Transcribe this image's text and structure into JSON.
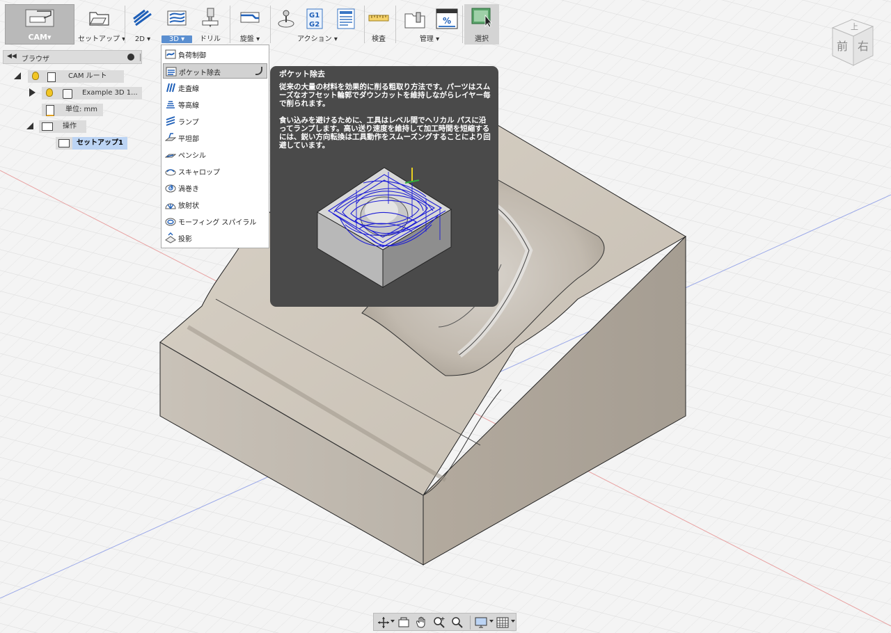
{
  "toolbar": {
    "workspace": {
      "label": "CAM▾"
    },
    "groups": [
      {
        "label": "セットアップ ▾"
      },
      {
        "label": "2D ▾"
      },
      {
        "label": "3D ▾"
      },
      {
        "label": "ドリル"
      },
      {
        "label": "旋盤 ▾"
      },
      {
        "label": "アクション ▾"
      },
      {
        "label": "検査"
      },
      {
        "label": "管理 ▾"
      },
      {
        "label": "選択"
      }
    ],
    "gcode_icon_text": [
      "G1",
      "G2"
    ],
    "manage_icon_text": "%"
  },
  "browser": {
    "title": "ブラウザ",
    "tree": [
      {
        "label": "CAM ルート"
      },
      {
        "label": "Example 3D 1..."
      },
      {
        "label": "単位: mm"
      },
      {
        "label": "操作"
      },
      {
        "label": "セットアップ1"
      }
    ]
  },
  "menu_3d": {
    "items": [
      {
        "label": "負荷制御"
      },
      {
        "label": "ポケット除去"
      },
      {
        "label": "走査線"
      },
      {
        "label": "等高線"
      },
      {
        "label": "ランプ"
      },
      {
        "label": "平坦部"
      },
      {
        "label": "ペンシル"
      },
      {
        "label": "スキャロップ"
      },
      {
        "label": "渦巻き"
      },
      {
        "label": "放射状"
      },
      {
        "label": "モーフィング スパイラル"
      },
      {
        "label": "投影"
      }
    ],
    "active_index": 1
  },
  "tooltip": {
    "title": "ポケット除去",
    "paragraph1": "従来の大量の材料を効果的に削る粗取り方法です。パーツはスムーズなオフセット輪郭でダウンカットを維持しながらレイヤー毎で削られます。",
    "paragraph2": "食い込みを避けるために、工具はレベル間でヘリカル パスに沿ってランプします。高い送り速度を維持して加工時間を短縮するには、鋭い方向転換は工具動作をスムーズングすることにより回避しています。"
  },
  "viewcube": {
    "top": "上",
    "front": "前",
    "right": "右"
  },
  "colors": {
    "accent": "#5b8fd0",
    "toolpath": "#1c1cd6",
    "tooltip_bg": "#4a4a4a",
    "model": "#cfc7bb"
  }
}
